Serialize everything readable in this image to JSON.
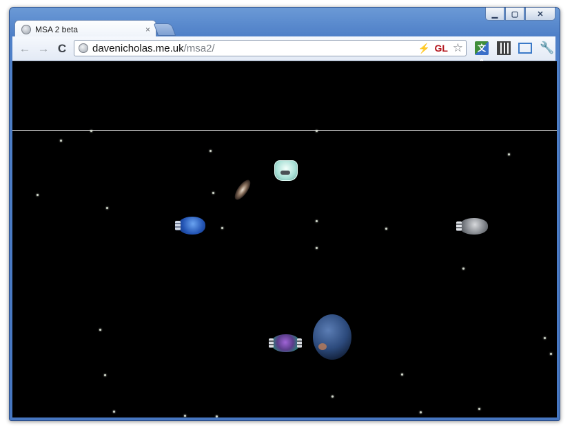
{
  "window": {
    "minimize_glyph": "▁",
    "maximize_glyph": "▢",
    "close_glyph": "✕"
  },
  "tab": {
    "title": "MSA 2 beta",
    "close_glyph": "×"
  },
  "toolbar": {
    "back_glyph": "←",
    "forward_glyph": "→",
    "reload_glyph": "C",
    "url_host": "davenicholas.me.uk",
    "url_path": "/msa2/",
    "bolt_glyph": "⚡",
    "gl_badge": "GL",
    "star_glyph": "☆",
    "translate_label": "文A",
    "wrench_glyph": "🔧"
  },
  "colors": {
    "frame": "#4f80c8",
    "content_background": "#000000",
    "hud_line": "#c9c9c9",
    "gl_badge": "#b3141b"
  }
}
